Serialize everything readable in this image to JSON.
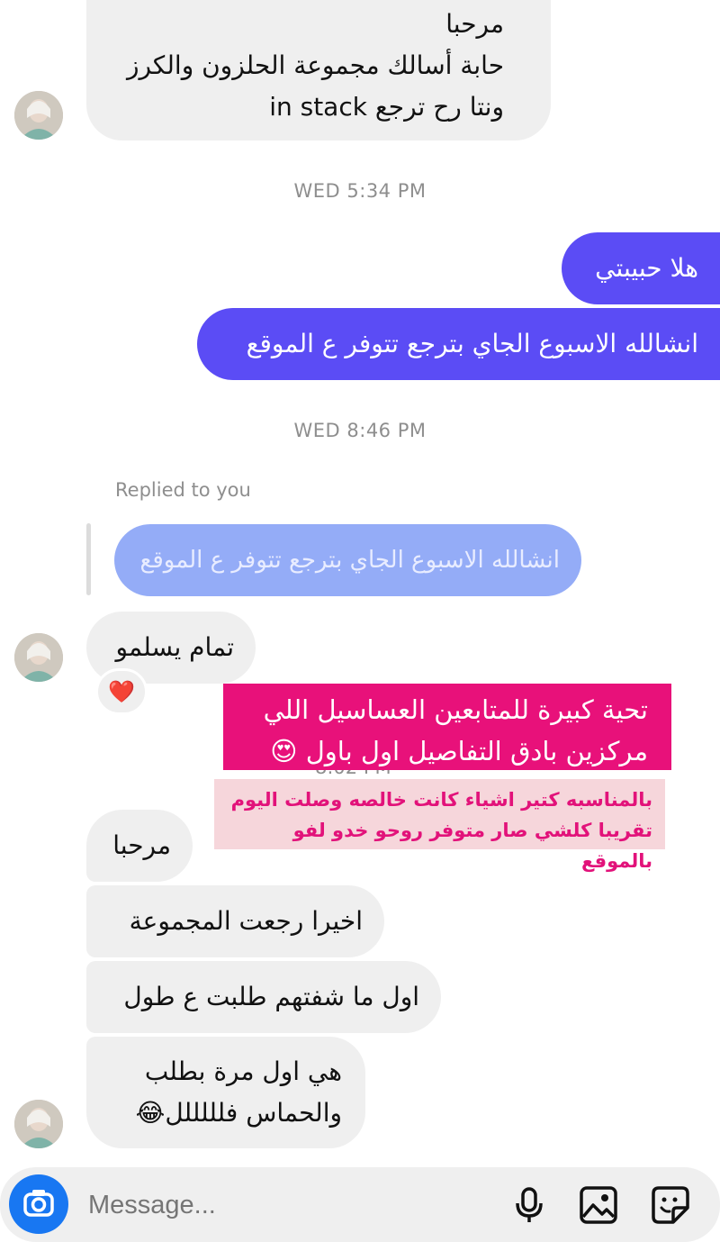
{
  "messages": {
    "first_incoming": {
      "line1": "مرحبا",
      "line2": "حابة أسالك مجموعة الحلزون والكرز",
      "line3": "ونتا رح ترجع  in stack"
    },
    "ts1": "WED 5:34 PM",
    "out1": "هلا حبيبتي",
    "out2": "انشالله الاسبوع الجاي بترجع تتوفر ع الموقع",
    "ts2": "WED 8:46 PM",
    "replied_label": "Replied to you",
    "quoted": "انشالله الاسبوع الجاي بترجع تتوفر ع الموقع",
    "in_tamam": "تمام يسلمو",
    "reaction": "❤️",
    "ts3_partial": "8:02 PM",
    "in_marhaba": "مرحبا",
    "in_akhiran": "اخيرا رجعت المجموعة",
    "in_awal": "اول ما شفتهم طلبت ع طول",
    "in_last_line1": "هي اول مرة بطلب",
    "in_last_line2": "والحماس فلللللل😂"
  },
  "overlays": {
    "pink_line1": "تحية كبيرة للمتابعين العساسيل اللي",
    "pink_line2": "مركزين بادق التفاصيل اول باول 😍",
    "light_line1": "بالمناسبه كتير اشياء كانت خالصه وصلت اليوم",
    "light_line2": "تقريبا كلشي صار متوفر روحو خدو لفو بالموقع"
  },
  "composer": {
    "placeholder": "Message..."
  },
  "colors": {
    "outgoing": "#5b4cf5",
    "quoted": "#94acf7",
    "incoming": "#efefef",
    "camera": "#1877f2",
    "overlay_pink": "#e8117a",
    "overlay_light": "#f6d6db"
  },
  "icons": [
    "camera-icon",
    "microphone-icon",
    "gallery-icon",
    "sticker-icon"
  ]
}
